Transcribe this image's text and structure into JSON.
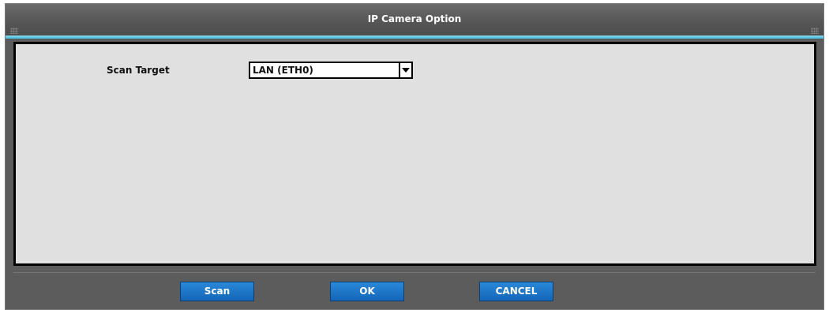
{
  "dialog": {
    "title": "IP Camera Option",
    "accent_color": "#3fb6d9"
  },
  "form": {
    "scan_target_label": "Scan Target",
    "scan_target_value": "LAN (ETH0)"
  },
  "buttons": {
    "scan": "Scan",
    "ok": "OK",
    "cancel": "CANCEL",
    "color": "#1a74c8"
  }
}
